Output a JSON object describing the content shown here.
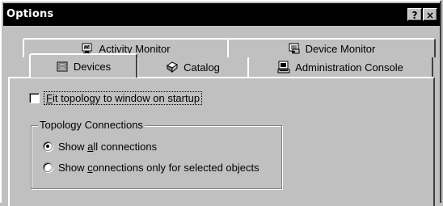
{
  "window": {
    "title": "Options",
    "help_label": "?",
    "close_label": "×"
  },
  "tabs": {
    "back_row": [
      {
        "label": "Activity Monitor",
        "icon": "activity-monitor-icon"
      },
      {
        "label": "Device Monitor",
        "icon": "device-monitor-icon"
      }
    ],
    "front_row": [
      {
        "label": "Devices",
        "icon": "devices-icon",
        "active": true
      },
      {
        "label": "Catalog",
        "icon": "catalog-icon"
      },
      {
        "label": "Administration Console",
        "icon": "administration-console-icon"
      }
    ]
  },
  "devices_panel": {
    "fit_topology": {
      "label_first": "F",
      "label_rest": "it topology to window on startup",
      "checked": false
    },
    "topology_group": {
      "label": "Topology Connections",
      "options": [
        {
          "pre": "Show ",
          "underline": "a",
          "post": "ll connections",
          "checked": true
        },
        {
          "pre": "Show ",
          "underline": "c",
          "post": "onnections only for selected objects",
          "checked": false
        }
      ]
    }
  }
}
